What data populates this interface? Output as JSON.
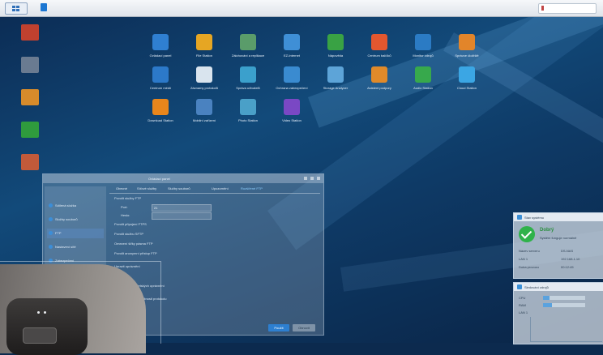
{
  "colors": {
    "accent": "#1b76d2",
    "ok_green": "#2fb24a",
    "desktop_bg": "#0c2a4e"
  },
  "taskbar": {
    "main_menu_icon": "grid-icon",
    "file_station_icon": "file-station-icon",
    "search_icon": "search-icon"
  },
  "desktop_icons": [
    {
      "icon": "app-shortcut-icon",
      "label": "",
      "color": "#c0412f"
    },
    {
      "icon": "drive-icon",
      "label": "",
      "color": "#6a7b91"
    },
    {
      "icon": "folder-icon",
      "label": "",
      "color": "#d78b2b"
    },
    {
      "icon": "help-book-icon",
      "label": "",
      "color": "#2f9b3d"
    },
    {
      "icon": "backup-icon",
      "label": "",
      "color": "#c25a3a"
    }
  ],
  "main_menu": [
    {
      "label": "Ovládací panel",
      "icon": "control-panel-icon",
      "color": "#2f7fd1"
    },
    {
      "label": "File Station",
      "icon": "file-station-icon",
      "color": "#e6a623"
    },
    {
      "label": "Zálohování a replikace",
      "icon": "backup-replication-icon",
      "color": "#5a9c6a"
    },
    {
      "label": "EZ-Internet",
      "icon": "ez-internet-icon",
      "color": "#3f8fd6"
    },
    {
      "label": "Nápověda",
      "icon": "help-icon",
      "color": "#39a244"
    },
    {
      "label": "Centrum balíčků",
      "icon": "package-center-icon",
      "color": "#e3572f"
    },
    {
      "label": "Monitor zdrojů",
      "icon": "resource-monitor-icon",
      "color": "#2b7bc4"
    },
    {
      "label": "Správce úložiště",
      "icon": "storage-manager-icon",
      "color": "#e2852a"
    },
    {
      "label": "Centrum médií",
      "icon": "media-center-icon",
      "color": "#2c79c9"
    },
    {
      "label": "Záznamy protokolů",
      "icon": "log-center-icon",
      "color": "#d9e4ee"
    },
    {
      "label": "Správa uživatelů",
      "icon": "user-icon",
      "color": "#3ba0cc"
    },
    {
      "label": "Ochrana zabezpečení",
      "icon": "security-advisor-icon",
      "color": "#3a8bd0"
    },
    {
      "label": "Storage Analyzer",
      "icon": "storage-analyzer-icon",
      "color": "#5da4d8"
    },
    {
      "label": "Asistent podpory",
      "icon": "support-icon",
      "color": "#e08a2a"
    },
    {
      "label": "Audio Station",
      "icon": "audio-station-icon",
      "color": "#37a94c"
    },
    {
      "label": "Cloud Station",
      "icon": "cloud-station-icon",
      "color": "#3ba6e4"
    },
    {
      "label": "Download Station",
      "icon": "download-station-icon",
      "color": "#e8861c"
    },
    {
      "label": "Mobilní zařízení",
      "icon": "mobile-devices-icon",
      "color": "#4a82c0"
    },
    {
      "label": "Photo Station",
      "icon": "photo-station-icon",
      "color": "#4aa0c8"
    },
    {
      "label": "Video Station",
      "icon": "video-station-icon",
      "color": "#7a48c4"
    }
  ],
  "control_panel": {
    "title": "Ovládací panel",
    "sidebar": [
      {
        "label": "Sdílená složka",
        "selected": false
      },
      {
        "label": "Služby souborů",
        "selected": false
      },
      {
        "label": "FTP",
        "selected": true
      },
      {
        "label": "Nastavení sítě",
        "selected": false
      },
      {
        "label": "Zabezpečení",
        "selected": false
      }
    ],
    "tabs": [
      {
        "label": "Obecné",
        "active": false
      },
      {
        "label": "Síťové služby",
        "active": false
      },
      {
        "label": "Služby souborů",
        "active": false
      },
      {
        "label": "Upozornění",
        "active": false
      },
      {
        "label": "Rozšířené FTP",
        "active": true
      }
    ],
    "body_lines": [
      "Povolit služby FTP",
      "Port:",
      "Heslo:",
      "Povolit připojení FTPS",
      "Povolit službu SFTP",
      "Omezení šířky pásma FTP",
      "Povolit anonymní přístup FTP",
      "Upravit oprávnění",
      "Nastavení uživatelských oprávnění",
      "Povolit rozšířené možnosti protokolu"
    ],
    "fields": [
      {
        "value": "21"
      },
      {
        "value": ""
      }
    ],
    "buttons": {
      "apply": "Použít",
      "reset": "Obnovit"
    }
  },
  "widgets": {
    "system_health": {
      "title": "Stav systému",
      "status": "Dobrý",
      "message": "Systém funguje normálně",
      "rows": [
        {
          "k": "Název serveru",
          "v": "DS-NAS"
        },
        {
          "k": "LAN 1",
          "v": "192.168.1.10"
        },
        {
          "k": "Doba provozu",
          "v": "00:12:45"
        }
      ]
    },
    "resource_monitor": {
      "title": "Sledování zdrojů",
      "cpu_label": "CPU",
      "ram_label": "RAM",
      "lan_label": "LAN 1",
      "cpu_usage": 0.16,
      "ram_usage": 0.22
    }
  }
}
